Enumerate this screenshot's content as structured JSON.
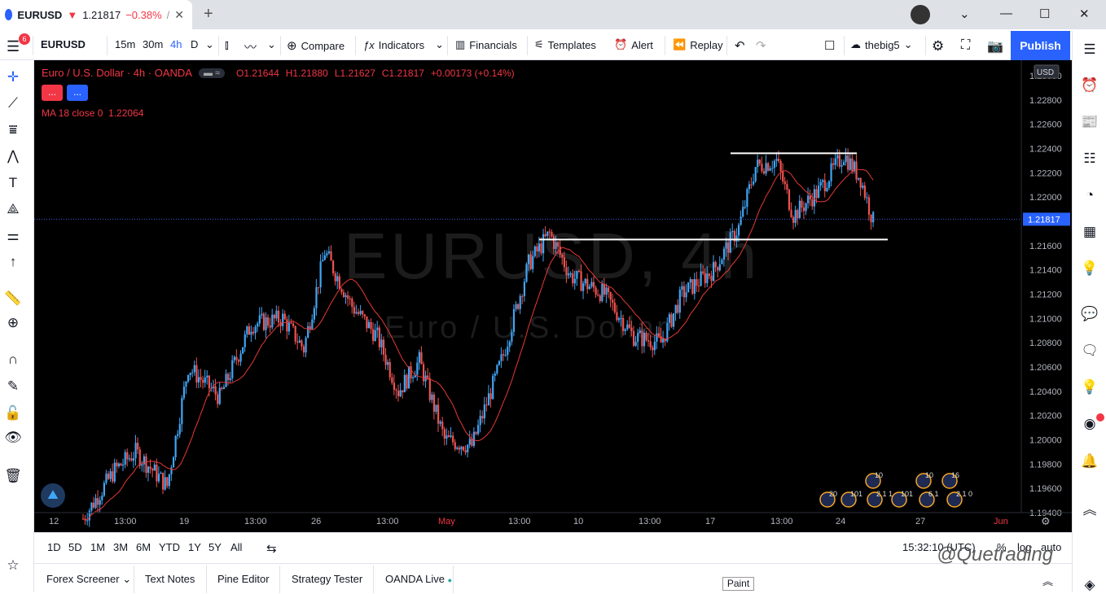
{
  "browser": {
    "tab_symbol": "EURUSD",
    "tab_arrow": "▼",
    "tab_price": "1.21817",
    "tab_change": "−0.38%",
    "tab_sep": "/",
    "tab_close": "✕",
    "new_tab": "+"
  },
  "window": {
    "minimize": "—",
    "maximize": "☐",
    "close": "✕",
    "menu_caret": "⌄"
  },
  "toolbar": {
    "badge": "6",
    "symbol": "EURUSD",
    "intervals": [
      "15m",
      "30m",
      "4h",
      "D"
    ],
    "active_interval": "4h",
    "compare": "Compare",
    "indicators": "Indicators",
    "financials": "Financials",
    "templates": "Templates",
    "alert": "Alert",
    "replay": "Replay",
    "layout_name": "thebig5",
    "publish": "Publish"
  },
  "chart": {
    "title": "Euro / U.S. Dollar · 4h · OANDA",
    "ohlc": {
      "o": "O1.21644",
      "h": "H1.21880",
      "l": "L1.21627",
      "c": "C1.21817",
      "chg": "+0.00173 (+0.14%)"
    },
    "pill": "▬ ≈",
    "btn1": "...",
    "btn2": "...",
    "ma_label": "MA 18 close 0",
    "ma_value": "1.22064",
    "watermark": "EURUSD, 4h",
    "watermark2": "Euro / U.S. Dollar",
    "currency": "USD",
    "current_price": "1.21817",
    "y_ticks": [
      "1.23000",
      "1.22800",
      "1.22600",
      "1.22400",
      "1.22200",
      "1.22000",
      "1.21800",
      "1.21600",
      "1.21400",
      "1.21200",
      "1.21000",
      "1.20800",
      "1.20600",
      "1.20400",
      "1.20200",
      "1.20000",
      "1.19800",
      "1.19600",
      "1.19400"
    ],
    "x_ticks": [
      "12",
      "13:00",
      "19",
      "13:00",
      "26",
      "13:00",
      "May",
      "13:00",
      "10",
      "13:00",
      "17",
      "13:00",
      "24",
      "27",
      "Jun"
    ],
    "event_counts": [
      "10",
      "10",
      "16",
      "20",
      "101",
      "2 1 1",
      "101",
      "6 1",
      "2 1 0"
    ],
    "colors": {
      "up": "#42a5f5",
      "down": "#ef5350",
      "ma": "#e53935",
      "level": "#ffffff",
      "bg": "#000000"
    }
  },
  "chart_data": {
    "type": "candlestick",
    "title": "Euro / U.S. Dollar · 4h · OANDA",
    "ylim": [
      1.194,
      1.231
    ],
    "levels": [
      1.2236,
      1.2165
    ],
    "last_close": 1.21817,
    "ma_period": 18
  },
  "bottom": {
    "ranges": [
      "1D",
      "5D",
      "1M",
      "3M",
      "6M",
      "YTD",
      "1Y",
      "5Y",
      "All"
    ],
    "time": "15:32:10 (UTC)",
    "pct": "%",
    "log": "log",
    "auto": "auto"
  },
  "panels": {
    "tabs": [
      "Forex Screener",
      "Text Notes",
      "Pine Editor",
      "Strategy Tester",
      "OANDA Live"
    ],
    "paint_tooltip": "Paint"
  },
  "credit": "@Quetrading"
}
